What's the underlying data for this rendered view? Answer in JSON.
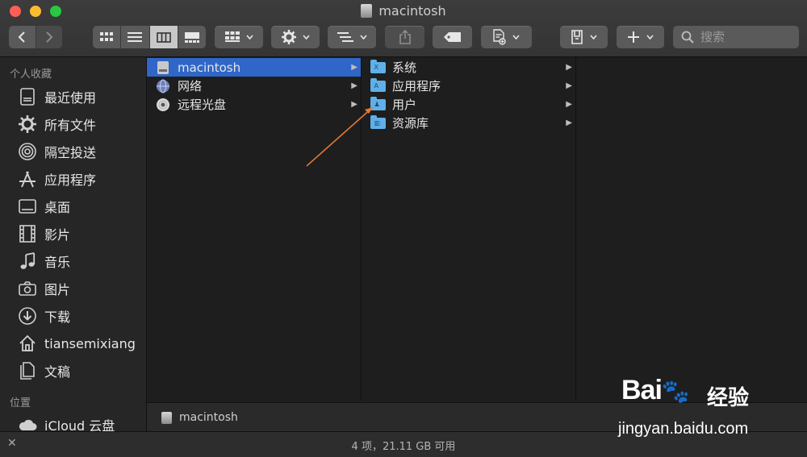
{
  "window": {
    "title": "macintosh",
    "traffic_colors": {
      "close": "#fc5f57",
      "minimize": "#fdbc2e",
      "zoom": "#28c840"
    }
  },
  "toolbar": {
    "back_icon": "chevron-left-icon",
    "forward_icon": "chevron-right-icon",
    "view_modes": [
      "icon-view",
      "list-view",
      "column-view",
      "gallery-view"
    ],
    "active_view": "column-view",
    "search_placeholder": "搜索"
  },
  "sidebar": {
    "favorites_header": "个人收藏",
    "favorites": [
      {
        "label": "最近使用",
        "icon": "recents-icon"
      },
      {
        "label": "所有文件",
        "icon": "gear-icon"
      },
      {
        "label": "隔空投送",
        "icon": "airdrop-icon"
      },
      {
        "label": "应用程序",
        "icon": "applications-icon"
      },
      {
        "label": "桌面",
        "icon": "desktop-icon"
      },
      {
        "label": "影片",
        "icon": "film-icon"
      },
      {
        "label": "音乐",
        "icon": "music-icon"
      },
      {
        "label": "图片",
        "icon": "camera-icon"
      },
      {
        "label": "下载",
        "icon": "download-icon"
      },
      {
        "label": "tiansemixiang",
        "icon": "home-icon"
      },
      {
        "label": "文稿",
        "icon": "documents-icon"
      }
    ],
    "locations_header": "位置",
    "locations": [
      {
        "label": "iCloud 云盘",
        "icon": "cloud-icon"
      }
    ]
  },
  "columns": {
    "col1": [
      {
        "label": "macintosh",
        "icon": "disk-icon",
        "selected": true
      },
      {
        "label": "网络",
        "icon": "network-icon",
        "selected": false
      },
      {
        "label": "远程光盘",
        "icon": "cd-icon",
        "selected": false
      }
    ],
    "col2": [
      {
        "label": "系统",
        "icon": "system-folder-icon",
        "selected": false
      },
      {
        "label": "应用程序",
        "icon": "applications-folder-icon",
        "selected": false
      },
      {
        "label": "用户",
        "icon": "users-folder-icon",
        "selected": false
      },
      {
        "label": "资源库",
        "icon": "library-folder-icon",
        "selected": false
      }
    ]
  },
  "pathbar": {
    "item": "macintosh"
  },
  "status": {
    "text": "4 项，21.11 GB 可用"
  },
  "annotation": {
    "color": "#e07a3a"
  },
  "watermark": {
    "brand": "Bai",
    "brand_cn": "经验",
    "url": "jingyan.baidu.com"
  },
  "colors": {
    "selection": "#2f66c8",
    "folder": "#5fb0e8"
  }
}
